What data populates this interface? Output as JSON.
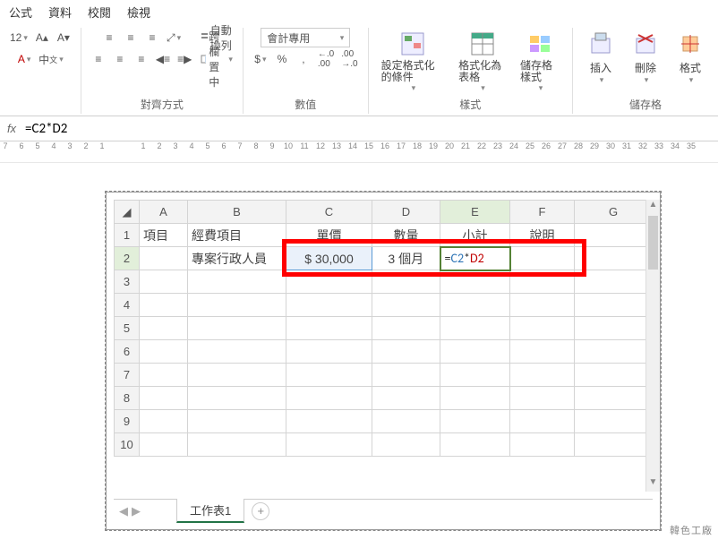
{
  "menu": {
    "formulas": "公式",
    "data": "資料",
    "review": "校閱",
    "view": "檢視"
  },
  "ribbon": {
    "font": {
      "size": "12"
    },
    "alignment": {
      "wrap": "自動換列",
      "merge": "跨欄置中",
      "group": "對齊方式"
    },
    "number": {
      "format": "會計專用",
      "currency": "$",
      "percent": "%",
      "comma": ",",
      "inc": ".0₁.00",
      "dec": ".00₁.0",
      "group": "數值"
    },
    "styles": {
      "cond": "設定格式化的條件",
      "table": "格式化為表格",
      "cell": "儲存格樣式",
      "group": "樣式"
    },
    "cells": {
      "insert": "插入",
      "delete": "刪除",
      "format": "格式",
      "group": "儲存格"
    }
  },
  "formula_bar": {
    "value": "=C2*D2"
  },
  "headers": {
    "cols": [
      "A",
      "B",
      "C",
      "D",
      "E",
      "F",
      "G"
    ]
  },
  "rows": {
    "r1": {
      "A": "項目",
      "B": "經費項目",
      "C": "單價",
      "D": "數量",
      "E": "小計",
      "F": "說明"
    },
    "r2": {
      "B": "專案行政人員",
      "C": "$ 30,000",
      "D": "3 個月",
      "E_eq": "=",
      "E_refC": "C2",
      "E_op": "*",
      "E_refD": "D2"
    }
  },
  "sheet_tab": {
    "name": "工作表1"
  },
  "watermark": "韓色工廠"
}
